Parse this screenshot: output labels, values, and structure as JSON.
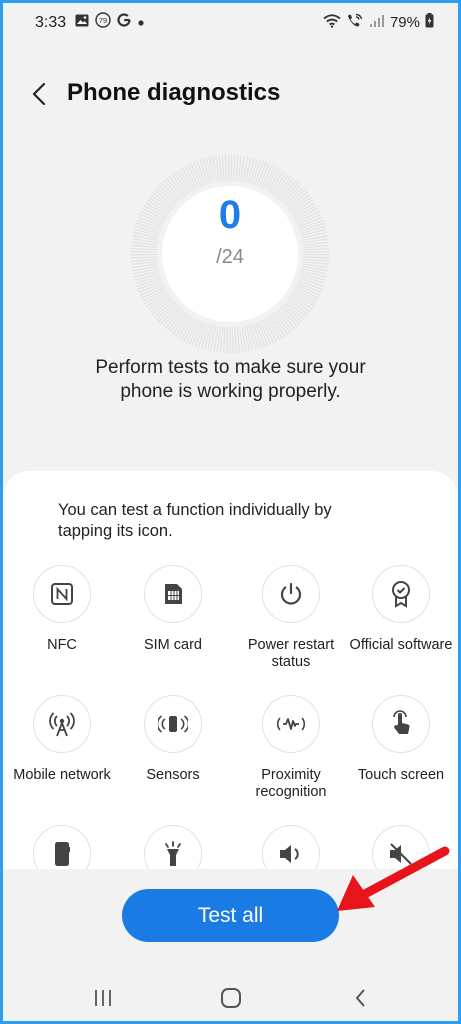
{
  "status_bar": {
    "time": "3:33",
    "battery": "79%",
    "icons": [
      "gallery-icon",
      "temperature-79-icon",
      "google-icon",
      "dot-icon",
      "wifi-icon",
      "wifi-calling-icon",
      "signal-icon",
      "battery-icon"
    ],
    "badge": "79"
  },
  "header": {
    "title": "Phone diagnostics"
  },
  "score": {
    "value": "0",
    "total": "/24"
  },
  "description": "Perform tests to make sure your phone is working properly.",
  "card": {
    "hint": "You can test a function individually by tapping its icon.",
    "tests": [
      {
        "label": "NFC",
        "icon": "nfc-icon"
      },
      {
        "label": "SIM card",
        "icon": "sim-card-icon"
      },
      {
        "label": "Power restart status",
        "icon": "power-restart-icon"
      },
      {
        "label": "Official software",
        "icon": "official-software-icon"
      },
      {
        "label": "Mobile network",
        "icon": "mobile-network-icon"
      },
      {
        "label": "Sensors",
        "icon": "sensors-icon"
      },
      {
        "label": "Proximity recognition",
        "icon": "proximity-icon"
      },
      {
        "label": "Touch screen",
        "icon": "touch-screen-icon"
      },
      {
        "label": "",
        "icon": "phone-icon"
      },
      {
        "label": "",
        "icon": "flashlight-icon"
      },
      {
        "label": "",
        "icon": "speaker-icon"
      },
      {
        "label": "",
        "icon": "vibration-icon"
      }
    ]
  },
  "actions": {
    "test_all_label": "Test all"
  },
  "nav_bar": {
    "items": [
      "recent-apps-icon",
      "home-icon",
      "back-nav-icon"
    ]
  },
  "colors": {
    "accent": "#1b7be4",
    "score": "#1e7de6",
    "annotation_arrow": "#e8141b"
  }
}
